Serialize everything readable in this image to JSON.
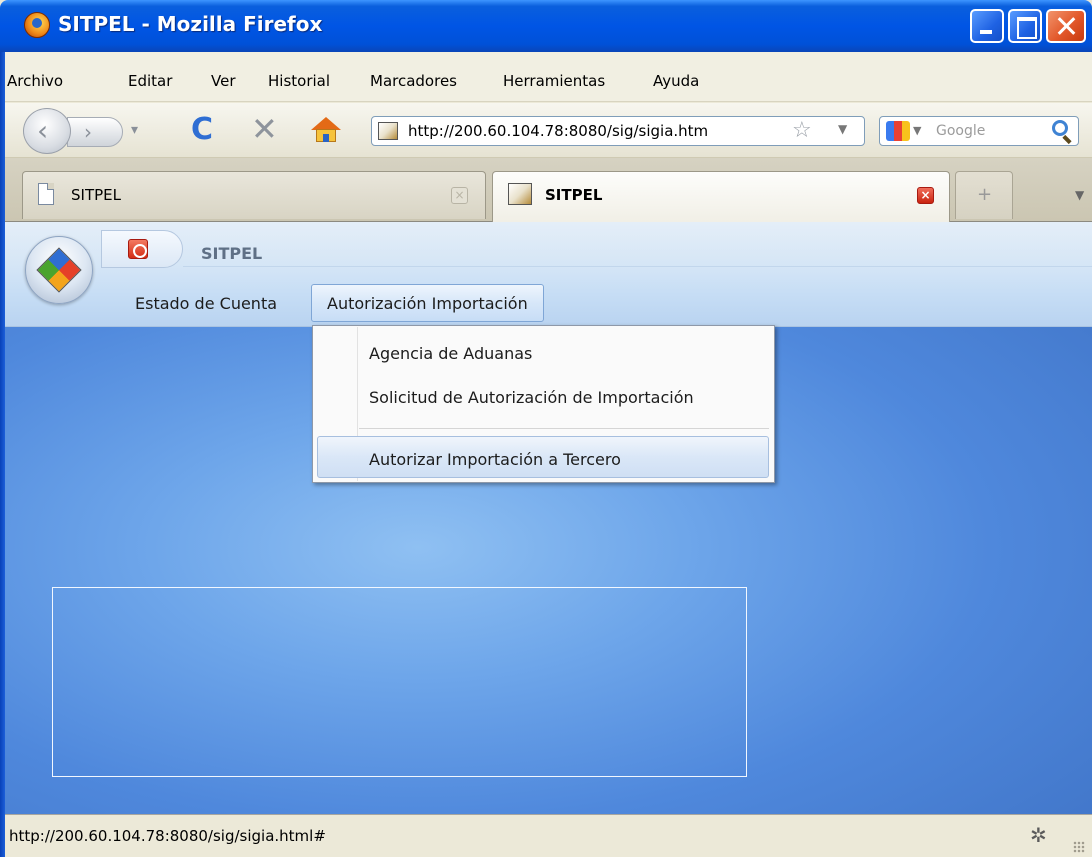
{
  "window": {
    "title": "SITPEL - Mozilla Firefox"
  },
  "menubar": {
    "items": [
      {
        "label": "Archivo"
      },
      {
        "label": "Editar"
      },
      {
        "label": "Ver"
      },
      {
        "label": "Historial"
      },
      {
        "label": "Marcadores"
      },
      {
        "label": "Herramientas"
      },
      {
        "label": "Ayuda"
      }
    ]
  },
  "navbar": {
    "url": "http://200.60.104.78:8080/sig/sigia.htm",
    "search_placeholder": "Google"
  },
  "tabs": [
    {
      "label": "SITPEL",
      "active": false
    },
    {
      "label": "SITPEL",
      "active": true
    }
  ],
  "app": {
    "title": "SITPEL",
    "menu": {
      "estado": "Estado de Cuenta",
      "autorizacion": "Autorización Importación"
    },
    "dropdown": [
      {
        "label": "Agencia de Aduanas"
      },
      {
        "label": "Solicitud de Autorización de Importación"
      },
      {
        "label": "Autorizar Importación a Tercero",
        "highlighted": true
      }
    ]
  },
  "status": {
    "text": "http://200.60.104.78:8080/sig/sigia.html#"
  },
  "colors": {
    "titlebar": "#0055e5",
    "desktop_blue": "#6ea6ea",
    "menu_highlight": "#dae7f7"
  }
}
